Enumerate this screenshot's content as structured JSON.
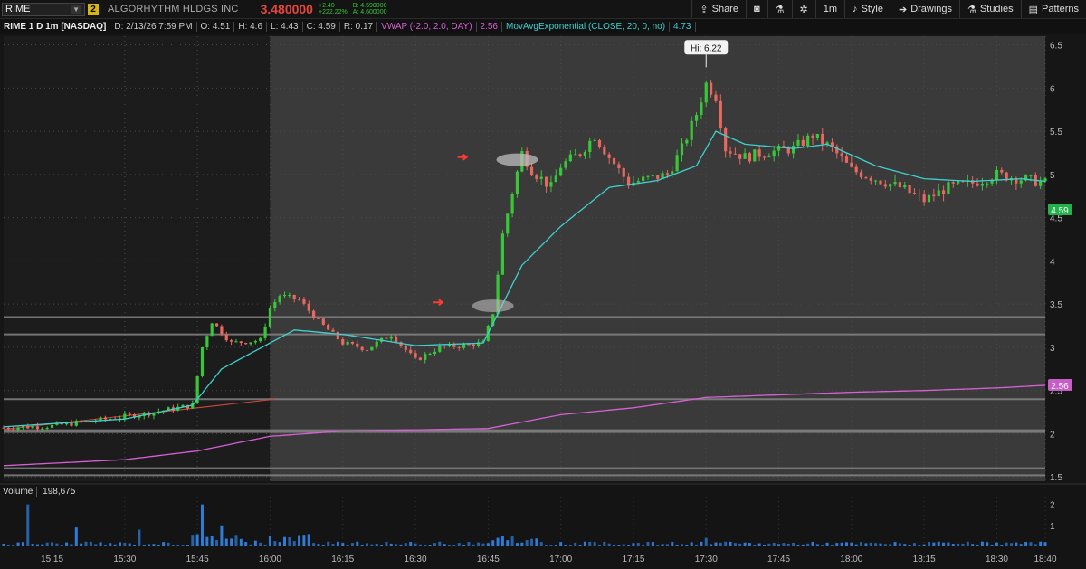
{
  "header": {
    "symbol": "RIME",
    "link_badge": "2",
    "company": "ALGORHYTHM HLDGS INC",
    "last_price": "3.480000",
    "change": "+2.40",
    "change_pct": "+222.22%",
    "bid": "B: 4.590000",
    "ask": "A: 4.600000",
    "share_label": "Share",
    "timeframe": "1m",
    "style_label": "Style",
    "drawings_label": "Drawings",
    "studies_label": "Studies",
    "patterns_label": "Patterns"
  },
  "infobar": {
    "title": "RIME 1 D 1m [NASDAQ]",
    "date": "D: 2/13/26 7:59 PM",
    "open": "O: 4.51",
    "high": "H: 4.6",
    "low": "L: 4.43",
    "close": "C: 4.59",
    "range": "R: 0.17",
    "vwap_label": "VWAP (-2.0, 2.0, DAY)",
    "vwap_value": "2.56",
    "ma_label": "MovAvgExponential (CLOSE, 20, 0, no)",
    "ma_value": "4.73"
  },
  "volume_panel": {
    "label": "Volume",
    "value": "198,675"
  },
  "colors": {
    "up": "#39c639",
    "down": "#e8675f",
    "vwap": "#d660d6",
    "ema": "#3fd0d0",
    "highlight": "#3a3a3a",
    "premarket": "#1c1c1c"
  },
  "chart_data": {
    "type": "candlestick",
    "timeframe": "1m",
    "x_tick_labels": [
      "15:15",
      "15:30",
      "15:45",
      "16:00",
      "16:15",
      "16:30",
      "16:45",
      "17:00",
      "17:15",
      "17:30",
      "17:45",
      "18:00",
      "18:15",
      "18:30",
      "18:40"
    ],
    "xlim": [
      "15:05",
      "18:40"
    ],
    "ylim": [
      1.45,
      6.6
    ],
    "y_tick_labels": [
      "1.5",
      "2",
      "2.5",
      "3",
      "3.5",
      "4",
      "4.5",
      "5",
      "5.5",
      "6",
      "6.5"
    ],
    "highlight_start": "16:00",
    "horizontal_levels": [
      3.35,
      3.15,
      2.4,
      2.03,
      1.6,
      1.52
    ],
    "high_marker": {
      "label": "Hi: 6.22",
      "time": "17:30",
      "price": 6.22
    },
    "last_price_tag": "4.59",
    "vwap_tag": "2.56",
    "candle_keypoints": [
      [
        "15:05",
        2.07
      ],
      [
        "15:15",
        2.09
      ],
      [
        "15:25",
        2.16
      ],
      [
        "15:35",
        2.24
      ],
      [
        "15:44",
        2.33
      ],
      [
        "15:46",
        3.0
      ],
      [
        "15:48",
        3.3
      ],
      [
        "15:52",
        3.05
      ],
      [
        "15:58",
        3.08
      ],
      [
        "16:00",
        3.45
      ],
      [
        "16:02",
        3.6
      ],
      [
        "16:06",
        3.55
      ],
      [
        "16:10",
        3.3
      ],
      [
        "16:15",
        3.05
      ],
      [
        "16:20",
        2.98
      ],
      [
        "16:25",
        3.15
      ],
      [
        "16:30",
        2.85
      ],
      [
        "16:35",
        3.0
      ],
      [
        "16:40",
        3.02
      ],
      [
        "16:44",
        3.05
      ],
      [
        "16:46",
        3.4
      ],
      [
        "16:48",
        4.3
      ],
      [
        "16:50",
        4.8
      ],
      [
        "16:52",
        5.25
      ],
      [
        "16:54",
        5.05
      ],
      [
        "16:58",
        4.85
      ],
      [
        "17:00",
        5.1
      ],
      [
        "17:04",
        5.25
      ],
      [
        "17:07",
        5.45
      ],
      [
        "17:10",
        5.2
      ],
      [
        "17:14",
        4.9
      ],
      [
        "17:18",
        4.95
      ],
      [
        "17:22",
        5.0
      ],
      [
        "17:25",
        5.3
      ],
      [
        "17:28",
        5.7
      ],
      [
        "17:30",
        6.05
      ],
      [
        "17:32",
        5.9
      ],
      [
        "17:34",
        5.3
      ],
      [
        "17:38",
        5.2
      ],
      [
        "17:42",
        5.25
      ],
      [
        "17:48",
        5.3
      ],
      [
        "17:52",
        5.45
      ],
      [
        "17:56",
        5.3
      ],
      [
        "18:00",
        5.05
      ],
      [
        "18:05",
        4.95
      ],
      [
        "18:10",
        4.85
      ],
      [
        "18:15",
        4.7
      ],
      [
        "18:20",
        4.85
      ],
      [
        "18:25",
        4.9
      ],
      [
        "18:30",
        5.0
      ],
      [
        "18:35",
        4.95
      ],
      [
        "18:40",
        4.9
      ]
    ],
    "vwap_keypoints": [
      [
        "15:05",
        1.63
      ],
      [
        "15:30",
        1.7
      ],
      [
        "15:45",
        1.8
      ],
      [
        "16:00",
        1.97
      ],
      [
        "16:15",
        2.03
      ],
      [
        "16:45",
        2.06
      ],
      [
        "17:00",
        2.22
      ],
      [
        "17:15",
        2.3
      ],
      [
        "17:30",
        2.42
      ],
      [
        "17:45",
        2.45
      ],
      [
        "18:00",
        2.48
      ],
      [
        "18:15",
        2.5
      ],
      [
        "18:30",
        2.53
      ],
      [
        "18:40",
        2.56
      ]
    ],
    "ema_keypoints": [
      [
        "15:05",
        2.08
      ],
      [
        "15:30",
        2.17
      ],
      [
        "15:44",
        2.33
      ],
      [
        "15:50",
        2.75
      ],
      [
        "16:00",
        3.05
      ],
      [
        "16:05",
        3.2
      ],
      [
        "16:15",
        3.15
      ],
      [
        "16:30",
        3.02
      ],
      [
        "16:44",
        3.05
      ],
      [
        "16:48",
        3.5
      ],
      [
        "16:52",
        3.95
      ],
      [
        "17:00",
        4.4
      ],
      [
        "17:10",
        4.85
      ],
      [
        "17:20",
        4.93
      ],
      [
        "17:28",
        5.1
      ],
      [
        "17:32",
        5.5
      ],
      [
        "17:38",
        5.35
      ],
      [
        "17:48",
        5.3
      ],
      [
        "17:55",
        5.35
      ],
      [
        "18:05",
        5.1
      ],
      [
        "18:15",
        4.95
      ],
      [
        "18:25",
        4.92
      ],
      [
        "18:35",
        4.95
      ],
      [
        "18:40",
        4.92
      ]
    ],
    "volume": {
      "ylim": [
        0,
        2.2
      ],
      "y_tick_labels": [
        "1",
        "2"
      ],
      "spikes": [
        [
          "15:10",
          2.0
        ],
        [
          "15:20",
          0.9
        ],
        [
          "15:33",
          0.8
        ],
        [
          "15:46",
          2.0
        ],
        [
          "15:50",
          1.0
        ],
        [
          "16:48",
          0.5
        ],
        [
          "17:30",
          0.4
        ]
      ]
    }
  }
}
